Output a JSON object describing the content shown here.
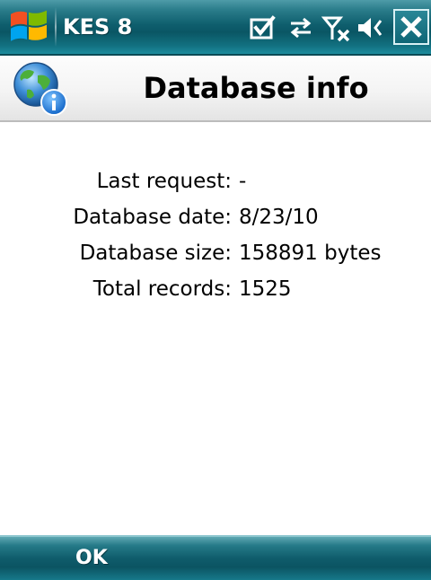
{
  "status_bar": {
    "app_title": "KES 8",
    "icons": [
      "windows-start-icon",
      "tasks-check-icon",
      "connectivity-arrows-icon",
      "signal-off-icon",
      "speaker-icon",
      "close-icon"
    ]
  },
  "header": {
    "title": "Database info",
    "icon": "globe-info-icon"
  },
  "info": [
    {
      "label": "Last request:",
      "value": "-"
    },
    {
      "label": "Database date:",
      "value": "8/23/10"
    },
    {
      "label": "Database size:",
      "value": "158891 bytes"
    },
    {
      "label": "Total records:",
      "value": "1525"
    }
  ],
  "softkeys": {
    "left": "OK"
  }
}
